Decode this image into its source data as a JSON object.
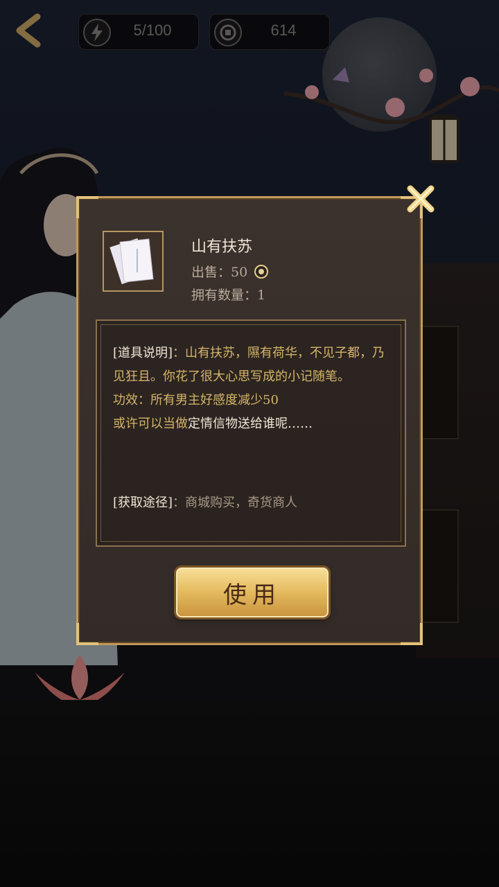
{
  "hud": {
    "stamina": "5/100",
    "coins": "614"
  },
  "item": {
    "name": "山有扶苏",
    "price_label": "出售：50",
    "owned_label": "拥有数量：1"
  },
  "description": {
    "label": "[道具说明]",
    "text": "：山有扶苏，隰有荷华，不见子都，乃见狂且。你花了很大心思写成的小记随笔。",
    "effect": "功效：所有男主好感度减少50",
    "hint_prefix": "或许可以当做",
    "hint_white": "定情信物送给谁呢",
    "hint_suffix": "……",
    "acquire_label": "[获取途径]",
    "acquire_text": "：商城购买，奇货商人"
  },
  "buttons": {
    "use": "使用"
  },
  "icons": {
    "back": "back-arrow-icon",
    "stamina": "lightning-icon",
    "coin": "coin-icon",
    "close": "close-icon"
  },
  "colors": {
    "gold": "#d6b56a",
    "frame": "#c29a58"
  }
}
